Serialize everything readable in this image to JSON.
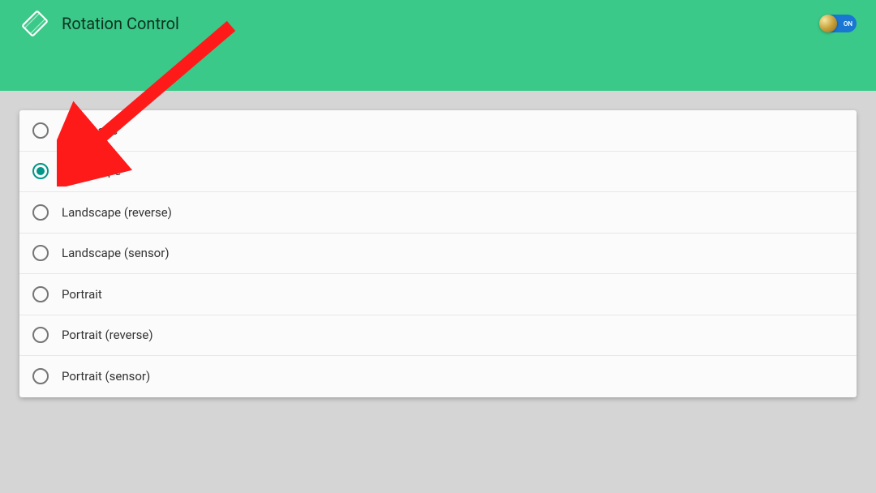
{
  "header": {
    "title": "Rotation Control",
    "toggle": {
      "on": true,
      "label": "ON"
    }
  },
  "options": [
    {
      "label": "Automatic",
      "selected": false
    },
    {
      "label": "Landscape",
      "selected": true
    },
    {
      "label": "Landscape (reverse)",
      "selected": false
    },
    {
      "label": "Landscape (sensor)",
      "selected": false
    },
    {
      "label": "Portrait",
      "selected": false
    },
    {
      "label": "Portrait (reverse)",
      "selected": false
    },
    {
      "label": "Portrait (sensor)",
      "selected": false
    }
  ]
}
